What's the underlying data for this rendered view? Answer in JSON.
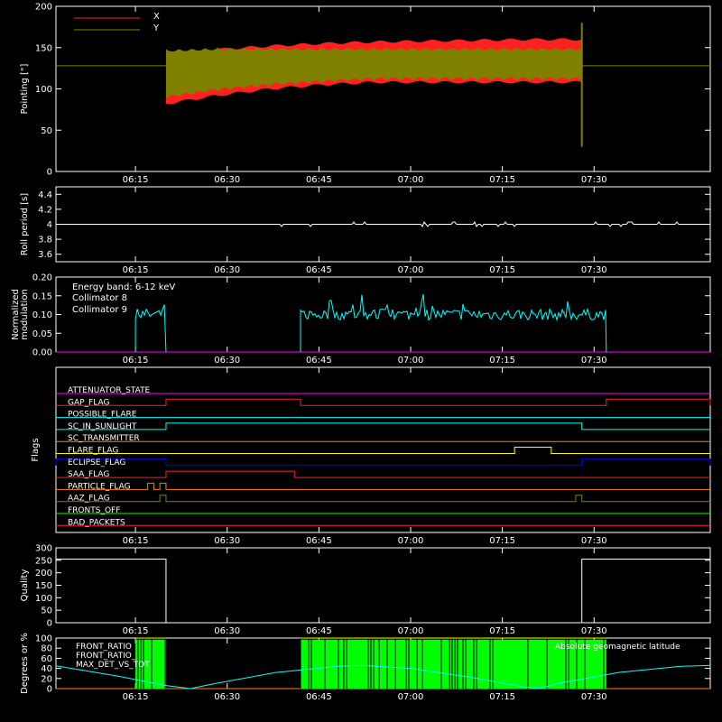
{
  "colors": {
    "axis": "#ffffff",
    "x": "#ff2020",
    "y": "#808000",
    "roll": "#ffffff",
    "coll8": "#00ffff",
    "coll9": "#ff00ff",
    "quality": "#ffffff",
    "green": "#00ff00",
    "cyan": "#00ffff",
    "yellow": "#ffff00",
    "orange": "#ff8000"
  },
  "time_ticks": [
    "06:15",
    "06:30",
    "06:45",
    "07:00",
    "07:15",
    "07:30"
  ],
  "chart_data": [
    {
      "type": "area",
      "ylabel": "Pointing [\"]",
      "xlim": [
        "06:02",
        "07:49"
      ],
      "ylim": [
        0,
        200
      ],
      "yticks": [
        0,
        50,
        100,
        150,
        200
      ],
      "legend": [
        "X",
        "Y"
      ],
      "series": [
        {
          "name": "X",
          "envelope_min": [
            82,
            92,
            100,
            105,
            108,
            108,
            108,
            108,
            108
          ],
          "envelope_max": [
            136,
            148,
            152,
            155,
            157,
            158,
            159,
            160,
            160
          ]
        },
        {
          "name": "Y",
          "envelope_min": [
            88,
            97,
            103,
            107,
            110,
            110,
            110,
            110,
            110
          ],
          "envelope_max": [
            148,
            150,
            150,
            150,
            150,
            150,
            150,
            150,
            150
          ]
        }
      ],
      "baseline": 128,
      "data_start": "06:20",
      "data_end": "07:28"
    },
    {
      "type": "line",
      "ylabel": "Roll period [s]",
      "ylim": [
        3.5,
        4.5
      ],
      "yticks": [
        3.6,
        3.8,
        4.0,
        4.2,
        4.4
      ],
      "values": [
        4.0
      ]
    },
    {
      "type": "line",
      "ylabel": "Normalized modulation",
      "ylim": [
        0,
        0.2
      ],
      "yticks": [
        "0.00",
        "0.05",
        "0.10",
        "0.15",
        "0.20"
      ],
      "legend": [
        "Energy band: 6-12 keV",
        "Collimator 8",
        "Collimator 9"
      ],
      "segments": [
        {
          "series": "Collimator 8",
          "start": "06:15",
          "end": "06:20",
          "level": 0.1
        },
        {
          "series": "Collimator 8",
          "start": "06:42",
          "end": "07:32",
          "level": 0.1
        }
      ]
    },
    {
      "type": "table",
      "ylabel": "Flags",
      "flags": [
        {
          "name": "ATTENUATOR_STATE",
          "color": "#ff00ff",
          "segments": []
        },
        {
          "name": "GAP_FLAG",
          "color": "#ff2020",
          "segments": [
            [
              "06:20",
              "06:42"
            ],
            [
              "07:32",
              "07:49"
            ]
          ]
        },
        {
          "name": "POSSIBLE_FLARE",
          "color": "#00ffff",
          "segments": []
        },
        {
          "name": "SC_IN_SUNLIGHT",
          "color": "#00ffff",
          "segments": [
            [
              "06:20",
              "07:28"
            ]
          ]
        },
        {
          "name": "SC_TRANSMITTER",
          "color": "#ff8000",
          "segments": []
        },
        {
          "name": "FLARE_FLAG",
          "color": "#ffff00",
          "segments": [
            [
              "07:17",
              "07:23"
            ]
          ]
        },
        {
          "name": "ECLIPSE_FLAG",
          "color": "#0000ff",
          "segments": [
            [
              "06:02",
              "06:20"
            ],
            [
              "07:28",
              "07:49"
            ]
          ]
        },
        {
          "name": "SAA_FLAG",
          "color": "#ff2020",
          "segments": [
            [
              "06:20",
              "06:41"
            ]
          ]
        },
        {
          "name": "PARTICLE_FLAG",
          "color": "#ff8000",
          "segments": [
            [
              "06:17",
              "06:18"
            ],
            [
              "06:19",
              "06:20"
            ]
          ]
        },
        {
          "name": "AAZ_FLAG",
          "color": "#808000",
          "segments": [
            [
              "06:19",
              "06:20"
            ],
            [
              "07:27",
              "07:28"
            ]
          ]
        },
        {
          "name": "FRONTS_OFF",
          "color": "#00ff00",
          "segments": []
        },
        {
          "name": "BAD_PACKETS",
          "color": "#ff2020",
          "segments": []
        }
      ]
    },
    {
      "type": "line",
      "ylabel": "Quality",
      "ylim": [
        0,
        300
      ],
      "yticks": [
        0,
        50,
        100,
        150,
        200,
        250,
        300
      ],
      "points": [
        [
          "06:02",
          255
        ],
        [
          "06:20",
          255
        ],
        [
          "06:20",
          0
        ],
        [
          "07:28",
          0
        ],
        [
          "07:28",
          255
        ],
        [
          "07:49",
          255
        ]
      ]
    },
    {
      "type": "bar",
      "ylabel": "Degrees or %",
      "ylim": [
        0,
        100
      ],
      "yticks": [
        0,
        20,
        40,
        60,
        80,
        100
      ],
      "legend": [
        "FRONT_RATIO",
        "FRONT_RATIO_",
        "MAX_DET_VS_TOT",
        "Absolute geomagnetic latitude"
      ],
      "ratio_segments": [
        [
          "06:15",
          "06:20"
        ],
        [
          "06:42",
          "07:32"
        ]
      ],
      "latitude": [
        [
          "06:02",
          45
        ],
        [
          "06:12",
          25
        ],
        [
          "06:20",
          6
        ],
        [
          "06:24",
          0
        ],
        [
          "06:28",
          10
        ],
        [
          "06:38",
          32
        ],
        [
          "06:48",
          44
        ],
        [
          "06:52",
          46
        ],
        [
          "07:00",
          40
        ],
        [
          "07:10",
          22
        ],
        [
          "07:18",
          4
        ],
        [
          "07:21",
          0
        ],
        [
          "07:24",
          10
        ],
        [
          "07:34",
          32
        ],
        [
          "07:44",
          44
        ],
        [
          "07:49",
          46
        ]
      ]
    }
  ]
}
